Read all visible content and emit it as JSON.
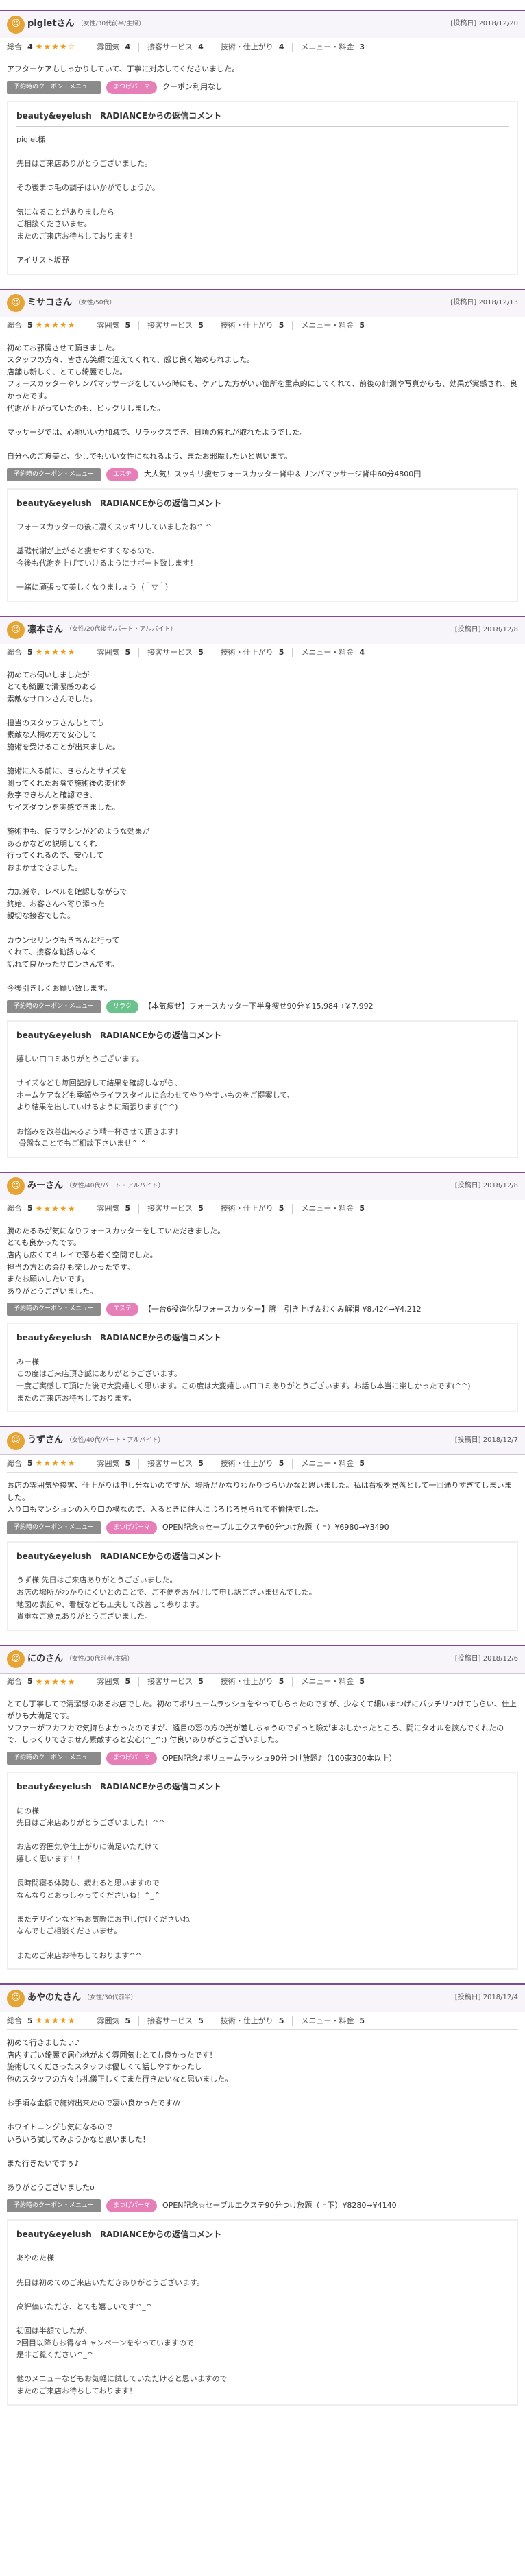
{
  "labels": {
    "overall": "総合",
    "atmosphere": "雰囲気",
    "service": "接客サービス",
    "skill": "技術・仕上がり",
    "menu": "メニュー・料金",
    "coupon_tag": "予約時のクーポン・メニュー",
    "date_prefix": "[投稿日]",
    "reply_title": "beauty&eyelush　RADIANCEからの返信コメント"
  },
  "reviews": [
    {
      "name": "pigletさん",
      "info": "（女性/30代前半/主婦）",
      "date": "2018/12/20",
      "overall": "4",
      "stars": "★★★★☆",
      "atmosphere": "4",
      "service": "4",
      "skill": "4",
      "menu": "3",
      "body": "アフターケアもしっかりしていて、丁寧に対応してくださいました。",
      "badge": "まつげパーマ",
      "badge_kind": "eye",
      "coupon": "クーポン利用なし",
      "reply": "piglet様\n\n先日はご来店ありがとうございました。\n\nその後まつ毛の調子はいかがでしょうか。\n\n気になることがありましたら\nご相談くださいませ。\nまたのご来店お待ちしております！\n\nアイリスト坂野"
    },
    {
      "name": "ミサコさん",
      "info": "（女性/50代）",
      "date": "2018/12/13",
      "overall": "5",
      "stars": "★★★★★",
      "atmosphere": "5",
      "service": "5",
      "skill": "5",
      "menu": "5",
      "body": "初めてお邪魔させて頂きました。\nスタッフの方々、皆さん笑顔で迎えてくれて、感じ良く始められました。\n店舗も新しく、とても綺麗でした。\nフォースカッターやリンパマッサージをしている時にも、ケアした方がいい箇所を重点的にしてくれて、前後の計測や写真からも、効果が実感され、良かったです。\n代謝が上がっていたのも、ビックリしました。\n\nマッサージでは、心地いい力加減で、リラックスでき、日頃の疲れが取れたようでした。\n\n自分へのご褒美と、少しでもいい女性になれるよう、またお邪魔したいと思います。",
      "badge": "エステ",
      "badge_kind": "este",
      "coupon": "大人気！スッキリ痩せフォースカッター背中＆リンパマッサージ背中60分4800円",
      "reply": "フォースカッターの後に凄くスッキリしていましたね^ ^\n\n基礎代謝が上がると痩せやすくなるので、\n今後も代謝を上げていけるようにサポート致します！\n\n一緒に頑張って美しくなりましょう（＾▽＾）"
    },
    {
      "name": "凛本さん",
      "info": "（女性/20代後半/パート・アルバイト）",
      "date": "2018/12/8",
      "overall": "5",
      "stars": "★★★★★",
      "atmosphere": "5",
      "service": "5",
      "skill": "5",
      "menu": "4",
      "body": "初めてお伺いしましたが\nとても綺麗で清潔感のある\n素敵なサロンさんでした。\n\n担当のスタッフさんもとても\n素敵な人柄の方で安心して\n施術を受けることが出来ました。\n\n施術に入る前に、きちんとサイズを\n測ってくれたお陰で施術後の変化を\n数字できちんと確認でき、\nサイズダウンを実感できました。\n\n施術中も、使うマシンがどのような効果が\nあるかなどの説明してくれ\n行ってくれるので、安心して\nおまかせできました。\n\n力加減や、レベルを確認しながらで\n終始、お客さんへ寄り添った\n親切な接客でした。\n\nカウンセリングもきちんと行って\nくれて、接客な勧誘もなく\n話れて良かったサロンさんです。\n\n今後引きしくお願い致します。",
      "badge": "リラク",
      "badge_kind": "relax",
      "coupon": "【本気痩せ】フォースカッター下半身痩せ90分￥15,984→￥7,992",
      "reply": "嬉しい口コミありがとうございます。\n\nサイズなども毎回記録して結果を確認しながら、\nホームケアなども季節やライフスタイルに合わせてやりやすいものをご提案して、\nより結果を出していけるように頑張ります(^^)\n\nお悩みを改善出来るよう精一杯させて頂きます！\n 骨盤なことでもご相談下さいませ^ ^"
    },
    {
      "name": "みーさん",
      "info": "（女性/40代/パート・アルバイト）",
      "date": "2018/12/8",
      "overall": "5",
      "stars": "★★★★★",
      "atmosphere": "5",
      "service": "5",
      "skill": "5",
      "menu": "5",
      "body": "腕のたるみが気になりフォースカッターをしていただきました。\nとても良かったです。\n店内も広くてキレイで落ち着く空間でした。\n担当の方との会話も楽しかったです。\nまたお願いしたいです。\nありがとうございました。",
      "badge": "エステ",
      "badge_kind": "este",
      "coupon": "【一台6役進化型フォースカッター】腕　引き上げ＆むくみ解消 ¥8,424→¥4,212",
      "reply": "みー様\nこの度はご来店頂き誠にありがとうございます。\n一度ご実感して頂けた後で大変嬉しく思います。この度は大変嬉しい口コミありがとうございます。お話も本当に楽しかったです(^^)\nまたのご来店お待ちしております。"
    },
    {
      "name": "うずさん",
      "info": "（女性/40代/パート・アルバイト）",
      "date": "2018/12/7",
      "overall": "5",
      "stars": "★★★★★",
      "atmosphere": "5",
      "service": "5",
      "skill": "5",
      "menu": "5",
      "body": "お店の雰囲気や接客、仕上がりは申し分ないのですが、場所がかなりわかりづらいかなと思いました。私は看板を見落として一回通りすぎてしまいました。\n入り口もマンションの入り口の横なので、入るときに住人にじろじろ見られて不愉快でした。",
      "badge": "まつげパーマ",
      "badge_kind": "eye",
      "coupon": "OPEN記念☆セーブルエクステ60分つけ放題（上）¥6980→¥3490",
      "reply": "うず様 先日はご来店ありがとうございました。\nお店の場所がわかりにくいとのことで、ご不便をおかけして申し訳ございませんでした。\n地図の表記や、看板なども工夫して改善して参ります。\n貴重なご意見ありがとうございました。"
    },
    {
      "name": "にのさん",
      "info": "（女性/30代前半/主婦）",
      "date": "2018/12/6",
      "overall": "5",
      "stars": "★★★★★",
      "atmosphere": "5",
      "service": "5",
      "skill": "5",
      "menu": "5",
      "body": "とても丁寧してで清潔感のあるお店でした。初めてボリュームラッシュをやってもらったのですが、少なくて細いまつげにパッチリつけてもらい、仕上がりも大満足です。\nソファーがフカフカで気持ちよかったのですが、遠目の窓の方の光が差しちゃうのでずっと瞼がまぶしかったところ、間にタオルを挟んでくれたので、しっくりできません素敵すると安心(^_^;) 付良いありがとうございました。",
      "badge": "まつげパーマ",
      "badge_kind": "eye",
      "coupon": "OPEN記念♪ボリュームラッシュ90分つけ放題♪（100束300本以上）",
      "reply": "にの様\n先日はご来店ありがとうございました！^^\n\nお店の雰囲気や仕上がりに満足いただけて\n嬉しく思います！！\n\n長時間寝る体勢も、疲れると思いますので\nなんなりとおっしゃってくださいね！^_^\n\nまたデザインなどもお気軽にお申し付けくださいね\nなんでもご相談くださいませ。\n\nまたのご来店お待ちしております^^"
    },
    {
      "name": "あやのたさん",
      "info": "（女性/30代前半）",
      "date": "2018/12/4",
      "overall": "5",
      "stars": "★★★★★",
      "atmosphere": "5",
      "service": "5",
      "skill": "5",
      "menu": "5",
      "body": "初めて行きましたぃ♪\n店内すごい綺麗で居心地がよく雰囲気もとても良かったです！\n施術してくださったスタッフは優しくて話しやすかったし\n他のスタッフの方々も礼儀正しくてまた行きたいなと思いました。\n\nお手頃な金額で施術出来たので凄い良かったです///\n\nホワイトニングも気になるので\nいろいろ試してみようかなと思いました！\n\nまた行きたいですぅ♪\n\nありがとうございましたo",
      "badge": "まつげパーマ",
      "badge_kind": "eye",
      "coupon": "OPEN記念☆セーブルエクステ90分つけ放題（上下）¥8280→¥4140",
      "reply": "あやのた様\n\n先日は初めてのご来店いただきありがとうございます。\n\n高評価いただき、とても嬉しいです^_^\n\n初回は半額でしたが、\n2回目以降もお得なキャンペーンをやっていますので\n是非ご覧ください^_^\n\n他のメニューなどもお気軽に試していただけると思いますので\nまたのご来店お待ちしております！"
    }
  ]
}
